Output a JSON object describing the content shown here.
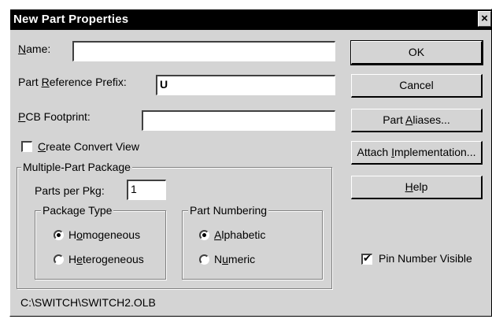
{
  "dialog": {
    "title": "New Part Properties",
    "close_label": "×"
  },
  "form": {
    "name_label_u": "N",
    "name_label_rest": "ame:",
    "name_value": "",
    "prefix_label_pre": "Part ",
    "prefix_label_u": "R",
    "prefix_label_rest": "eference Prefix:",
    "prefix_value": "U",
    "pcb_label_u": "P",
    "pcb_label_rest": "CB Footprint:",
    "pcb_value": "",
    "convert_label_u": "C",
    "convert_label_rest": "reate Convert View",
    "convert_checked": false
  },
  "package": {
    "legend": "Multiple-Part Package",
    "parts_label_pre": "Parts per Pk",
    "parts_label_u": "g",
    "parts_label_rest": ":",
    "parts_value": "1",
    "type": {
      "legend": "Package Type",
      "homogeneous_pre": "H",
      "homogeneous_u": "o",
      "homogeneous_rest": "mogeneous",
      "heterogeneous_pre": "H",
      "heterogeneous_u": "e",
      "heterogeneous_rest": "terogeneous",
      "selected": "Homogeneous"
    },
    "numbering": {
      "legend": "Part Numbering",
      "alphabetic_u": "A",
      "alphabetic_rest": "lphabetic",
      "numeric_pre": "N",
      "numeric_u": "u",
      "numeric_rest": "meric",
      "selected": "Alphabetic"
    }
  },
  "buttons": {
    "ok": "OK",
    "cancel": "Cancel",
    "aliases_pre": "Part ",
    "aliases_u": "A",
    "aliases_rest": "liases...",
    "attach_pre": "Attach ",
    "attach_u": "I",
    "attach_rest": "mplementation...",
    "help_u": "H",
    "help_rest": "elp"
  },
  "pin_number": {
    "label": "Pin Number Visible",
    "checked": true
  },
  "status": {
    "path": "C:\\SWITCH\\SWITCH2.OLB"
  }
}
